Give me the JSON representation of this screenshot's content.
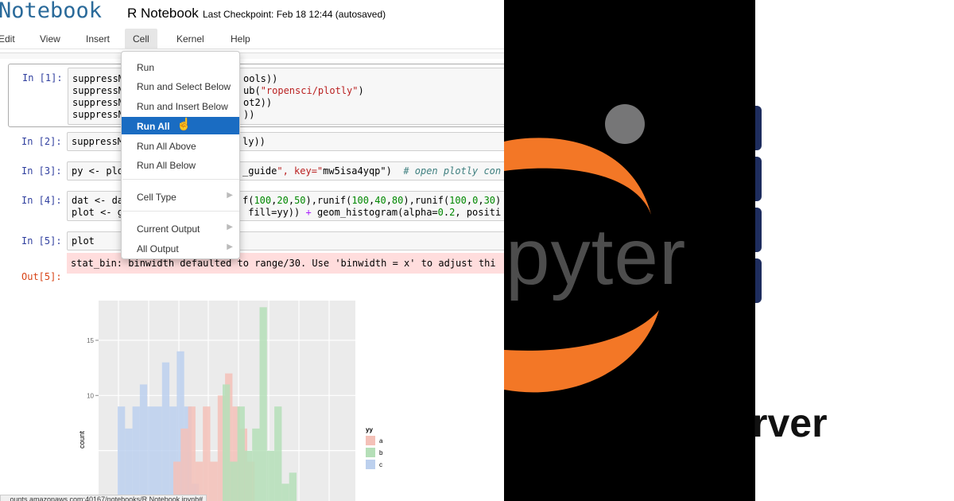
{
  "notebook": {
    "brand": "Notebook",
    "title": "R Notebook",
    "checkpoint": "Last Checkpoint: Feb 18 12:44 (autosaved)",
    "menu": [
      "Edit",
      "View",
      "Insert",
      "Cell",
      "Kernel",
      "Help"
    ],
    "active_menu": "Cell",
    "cells": [
      {
        "prompt": "In [1]:",
        "lines": [
          "suppressM",
          "suppressM",
          "suppressM",
          "suppressM"
        ],
        "tails": [
          "ools))",
          "ub(\"ropensci/plotly\")",
          "ot2))",
          "))"
        ]
      },
      {
        "prompt": "In [2]:",
        "lines": [
          "suppressM"
        ],
        "tails": [
          "ly))"
        ]
      },
      {
        "prompt": "In [3]:",
        "lines": [
          "py <- plo"
        ],
        "tails": [
          "_guide\", key=\"mw5isa4yqp\")  # open plotly con"
        ]
      },
      {
        "prompt": "In [4]:",
        "lines": [
          "dat <- da",
          "plot <- g"
        ],
        "tails": [
          "f(100,20,50),runif(100,40,80),runif(100,0,30)",
          " fill=yy)) + geom_histogram(alpha=0.2, positi"
        ]
      },
      {
        "prompt": "In [5]:",
        "lines": [
          "plot"
        ],
        "tails": [
          ""
        ]
      }
    ],
    "stderr": "stat_bin: binwidth defaulted to range/30. Use 'binwidth = x' to adjust thi",
    "out_prompt": "Out[5]:",
    "status_url": "...ounts.amazonaws.com:40167/notebooks/R Notebook.ipynb#"
  },
  "dropdown": {
    "items": [
      {
        "label": "Run",
        "submenu": false
      },
      {
        "label": "Run and Select Below",
        "submenu": false
      },
      {
        "label": "Run and Insert Below",
        "submenu": false
      },
      {
        "label": "Run All",
        "submenu": false,
        "highlighted": true
      },
      {
        "label": "Run All Above",
        "submenu": false
      },
      {
        "label": "Run All Below",
        "submenu": false
      },
      {
        "label": "Cell Type",
        "submenu": true
      },
      {
        "label": "Current Output",
        "submenu": true
      },
      {
        "label": "All Output",
        "submenu": true
      }
    ]
  },
  "chart_data": {
    "type": "bar",
    "ylabel": "count",
    "yticks": [
      10,
      15
    ],
    "legend_title": "yy",
    "legend_position": "right",
    "series": [
      {
        "name": "a",
        "color": "#f4c1b8"
      },
      {
        "name": "b",
        "color": "#b5dfb8"
      },
      {
        "name": "c",
        "color": "#bcd0ee"
      }
    ],
    "bars": [
      {
        "series": "c",
        "values": [
          9,
          7,
          9,
          11,
          9,
          9,
          13,
          9,
          14,
          9,
          2
        ]
      },
      {
        "series": "a",
        "values": [
          4,
          7,
          9,
          4,
          9,
          4,
          10,
          12,
          9,
          7,
          4
        ]
      },
      {
        "series": "b",
        "values": [
          11,
          4,
          9,
          5,
          7,
          18,
          5,
          9,
          2,
          3
        ]
      }
    ],
    "ylim": [
      0,
      18.6
    ]
  },
  "logo_panel": {
    "logo_text": "pyter",
    "right_text": "rver",
    "colors": {
      "orange": "#f37726",
      "gray": "#767677",
      "navy": "#1e2d5e"
    }
  }
}
